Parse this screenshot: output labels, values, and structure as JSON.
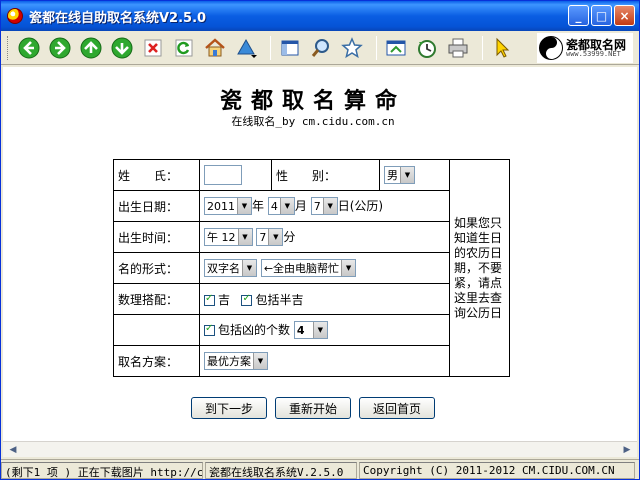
{
  "window": {
    "title": "瓷都在线自助取名系统V2.5.0",
    "buttons": {
      "minimize": "_",
      "maximize": "□",
      "close": "×"
    }
  },
  "toolbar": {
    "tools": [
      "back-icon",
      "forward-icon",
      "up-icon",
      "down-icon",
      "stop-icon",
      "refresh-icon",
      "home-icon",
      "triangle-menu-icon",
      "view-icon",
      "search-icon",
      "favorites-icon",
      "window-icon",
      "history-icon",
      "print-icon",
      "pointer-icon"
    ],
    "logo_text": "瓷都取名网",
    "logo_url": "www.53999.NET"
  },
  "page": {
    "title": "瓷都取名算命",
    "subtitle": "在线取名_by cm.cidu.com.cn"
  },
  "form": {
    "surname_label": "姓　　氏：",
    "surname_value": "",
    "gender_label": "性　　别：",
    "gender_value": "男",
    "birthdate_label": "出生日期：",
    "year_value": "2011",
    "year_unit": "年",
    "month_value": "4",
    "month_unit": "月",
    "day_value": "7",
    "day_unit": "日(公历)",
    "birthtime_label": "出生时间：",
    "hour_value": "午 12",
    "minute_value": "7",
    "minute_unit": "分",
    "name_form_label": "名的形式：",
    "name_form_value": "双字名",
    "name_char_value": "←全由电脑帮忙",
    "numerology_label": "数理搭配：",
    "lucky_label": "吉",
    "semi_lucky_label": "包括半吉",
    "bad_count_label": "包括凶的个数",
    "bad_count_value": "4",
    "plan_label": "取名方案：",
    "plan_value": "最优方案",
    "side_note": "如果您只知道生日的农历日期，不要紧，请点这里去查询公历日"
  },
  "buttons": {
    "next": "到下一步",
    "restart": "重新开始",
    "home": "返回首页"
  },
  "status": {
    "progress": "(剩下1 项 ) 正在下载图片 http://c",
    "app": "瓷都在线取名系统V.2.5.0",
    "copyright": "Copyright (C) 2011-2012 CM.CIDU.COM.CN"
  }
}
